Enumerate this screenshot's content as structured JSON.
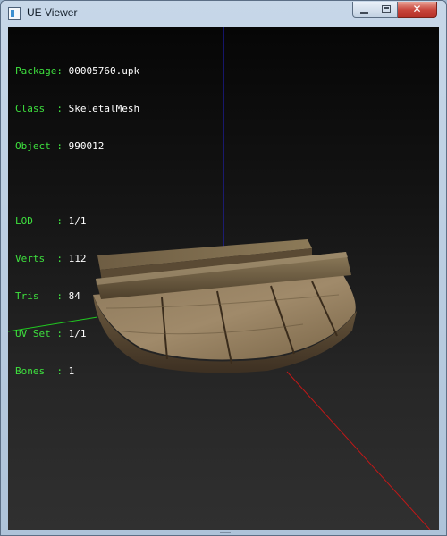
{
  "window": {
    "title": "UE Viewer",
    "icon": "window-app-icon",
    "controls": {
      "minimize_icon": "minimize-icon",
      "maximize_icon": "maximize-icon",
      "close_icon": "close-icon",
      "close_glyph": "✕"
    }
  },
  "info": {
    "package": {
      "label": "Package:",
      "value": "00005760.upk"
    },
    "class": {
      "label": "Class  :",
      "value": "SkeletalMesh"
    },
    "object": {
      "label": "Object :",
      "value": "990012"
    },
    "lod": {
      "label": "LOD    :",
      "value": "1/1"
    },
    "verts": {
      "label": "Verts  :",
      "value": "112"
    },
    "tris": {
      "label": "Tris   :",
      "value": "84"
    },
    "uvset": {
      "label": "UV Set :",
      "value": "1/1"
    },
    "bones": {
      "label": "Bones  :",
      "value": "1"
    }
  },
  "colors": {
    "label_green": "#3ee03e",
    "value_white": "#ffffff",
    "axis_x": "#c01818",
    "axis_y": "#21c821",
    "axis_z": "#2222cc"
  }
}
